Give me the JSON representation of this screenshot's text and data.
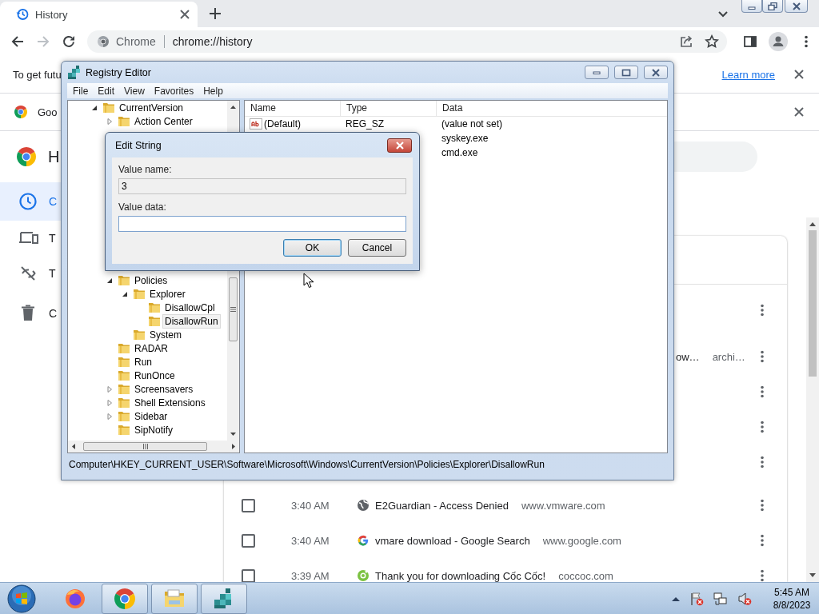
{
  "browser": {
    "tab": {
      "title": "History",
      "selected": true
    },
    "address": {
      "label": "Chrome",
      "url": "chrome://history"
    },
    "infobar": {
      "text": "To get futu",
      "link": "Learn more"
    },
    "promo_bar": {
      "text": "Goo"
    },
    "page": {
      "heading": "H",
      "nav": [
        {
          "label": "C",
          "selected": true
        },
        {
          "label": "T",
          "selected": false
        },
        {
          "label": "T",
          "selected": false
        },
        {
          "label": "C",
          "selected": false
        }
      ],
      "entries": [
        {
          "kind": "covered"
        },
        {
          "kind": "partial",
          "title": "ow…",
          "domain": "archi…"
        },
        {
          "kind": "covered"
        },
        {
          "kind": "covered"
        },
        {
          "kind": "covered"
        },
        {
          "kind": "full",
          "checked": false,
          "time": "3:40 AM",
          "title": "E2Guardian - Access Denied",
          "domain": "www.vmware.com"
        },
        {
          "kind": "full",
          "checked": false,
          "time": "3:40 AM",
          "title": "vmare download - Google Search",
          "domain": "www.google.com"
        },
        {
          "kind": "full",
          "checked": false,
          "time": "3:39 AM",
          "title": "Thank you for downloading Cốc Cốc!",
          "domain": "coccoc.com"
        }
      ]
    }
  },
  "registry_editor": {
    "title": "Registry Editor",
    "menu": [
      "File",
      "Edit",
      "View",
      "Favorites",
      "Help"
    ],
    "tree": [
      {
        "label": "CurrentVersion",
        "expanded": true,
        "selected": false,
        "children": [
          {
            "label": "Action Center",
            "expanded": false,
            "selected": false
          },
          {
            "label": "Policies",
            "expanded": true,
            "selected": false,
            "children": [
              {
                "label": "Explorer",
                "expanded": true,
                "selected": false,
                "children": [
                  {
                    "label": "DisallowCpl",
                    "selected": false
                  },
                  {
                    "label": "DisallowRun",
                    "selected": true
                  }
                ]
              },
              {
                "label": "System",
                "selected": false
              }
            ]
          },
          {
            "label": "RADAR",
            "selected": false
          },
          {
            "label": "Run",
            "selected": false
          },
          {
            "label": "RunOnce",
            "selected": false
          },
          {
            "label": "Screensavers",
            "expanded": false,
            "selected": false
          },
          {
            "label": "Shell Extensions",
            "expanded": false,
            "selected": false
          },
          {
            "label": "Sidebar",
            "expanded": false,
            "selected": false
          },
          {
            "label": "SipNotify",
            "selected": false
          }
        ]
      }
    ],
    "columns": [
      "Name",
      "Type",
      "Data"
    ],
    "values": [
      {
        "name": "(Default)",
        "type": "REG_SZ",
        "data": "(value not set)"
      },
      {
        "data": "syskey.exe"
      },
      {
        "data": "cmd.exe"
      }
    ],
    "status_bar": "Computer\\HKEY_CURRENT_USER\\Software\\Microsoft\\Windows\\CurrentVersion\\Policies\\Explorer\\DisallowRun"
  },
  "edit_string_dialog": {
    "title": "Edit String",
    "value_name_label": "Value name:",
    "value_name": "3",
    "value_data_label": "Value data:",
    "buttons": [
      {
        "label": "OK",
        "default": true
      },
      {
        "label": "Cancel",
        "default": false
      }
    ]
  },
  "taskbar": {
    "apps": [
      {
        "open": false
      },
      {
        "open": true
      },
      {
        "open": true
      },
      {
        "open": true
      }
    ],
    "time": "5:45 AM",
    "date": "8/8/2023"
  }
}
